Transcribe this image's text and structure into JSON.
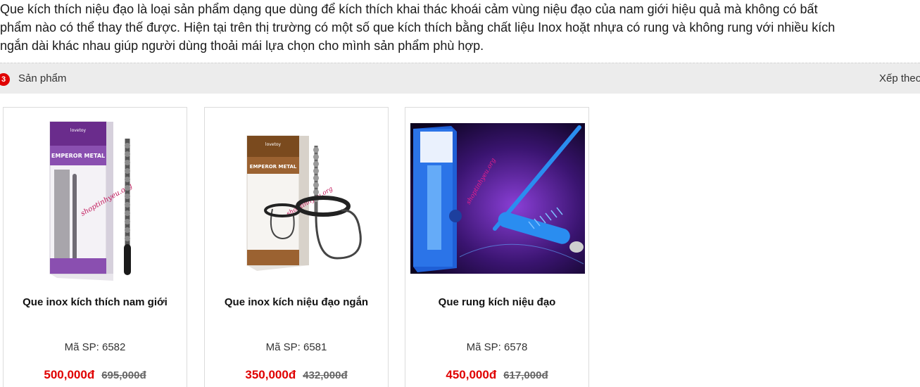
{
  "intro": {
    "line1": "Que kích thích niệu đạo là loại sản phẩm dạng que dùng để kích thích khai thác khoái cảm vùng niệu đạo của nam giới hiệu quả mà không có bất",
    "line2": "phẩm nào có thể thay thế được. Hiện tại trên thị trường có một số que kích thích bằng chất liệu Inox hoặt nhựa có rung và không rung với nhiều kích",
    "line3": "ngắn dài khác nhau giúp người dùng thoải mái lựa chọn cho mình sản phẩm phù hợp."
  },
  "toolbar": {
    "count": "3",
    "label": "Sản phẩm",
    "sort_label": "Xếp theo"
  },
  "products": [
    {
      "name": "Que inox kích thích nam giới",
      "sku": "Mã SP: 6582",
      "price": "500,000đ",
      "old_price": "695,000đ",
      "box_brand": "lovetoy",
      "box_title": "EMPEROR METAL",
      "watermark": "shoptinhyeu.org"
    },
    {
      "name": "Que inox kích niệu đạo ngắn",
      "sku": "Mã SP: 6581",
      "price": "350,000đ",
      "old_price": "432,000đ",
      "box_brand": "lovetoy",
      "box_title": "EMPEROR METAL",
      "watermark": "shoptinhyeu.org"
    },
    {
      "name": "Que rung kích niệu đạo",
      "sku": "Mã SP: 6578",
      "price": "450,000đ",
      "old_price": "617,000đ",
      "watermark": "shoptinhyeu.org"
    }
  ],
  "colors": {
    "price_red": "#e00000",
    "badge_red": "#e00000",
    "toolbar_bg": "#ececec"
  }
}
